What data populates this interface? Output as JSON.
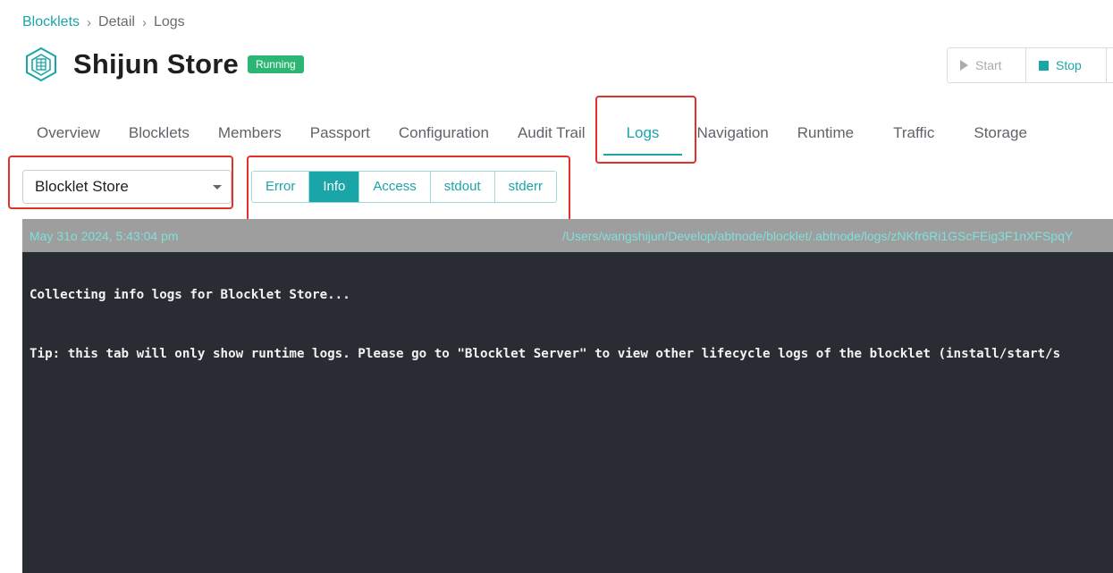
{
  "breadcrumb": {
    "root": "Blocklets",
    "sep1": "›",
    "detail": "Detail",
    "sep2": "›",
    "current": "Logs"
  },
  "header": {
    "title": "Shijun Store",
    "status": "Running"
  },
  "actions": {
    "start": "Start",
    "stop": "Stop"
  },
  "tabs": [
    {
      "label": "Overview"
    },
    {
      "label": "Blocklets"
    },
    {
      "label": "Members"
    },
    {
      "label": "Passport"
    },
    {
      "label": "Configuration"
    },
    {
      "label": "Audit Trail"
    },
    {
      "label": "Logs",
      "active": true
    },
    {
      "label": "Navigation"
    },
    {
      "label": "Runtime"
    },
    {
      "label": "Traffic"
    },
    {
      "label": "Storage"
    }
  ],
  "select": {
    "value": "Blocklet Store"
  },
  "log_types": [
    {
      "label": "Error"
    },
    {
      "label": "Info",
      "active": true
    },
    {
      "label": "Access"
    },
    {
      "label": "stdout"
    },
    {
      "label": "stderr"
    }
  ],
  "log": {
    "date": "May 31o 2024, 5:43:04 pm",
    "path": "/Users/wangshijun/Develop/abtnode/blocklet/.abtnode/logs/zNKfr6Ri1GScFEig3F1nXFSpqY",
    "lines": [
      "Collecting info logs for Blocklet Store...",
      "Tip: this tab will only show runtime logs. Please go to \"Blocklet Server\" to view other lifecycle logs of the blocklet (install/start/s"
    ]
  },
  "colors": {
    "accent": "#1aa5a8",
    "status_green": "#2bb673",
    "annotation_red": "#e0312d",
    "log_bg": "#2a2c33",
    "log_header_bg": "#9e9e9e"
  },
  "icons": {
    "app": "blocklet-hexagon-icon",
    "start": "play-icon",
    "stop": "stop-square-icon",
    "select": "caret-down-icon"
  }
}
